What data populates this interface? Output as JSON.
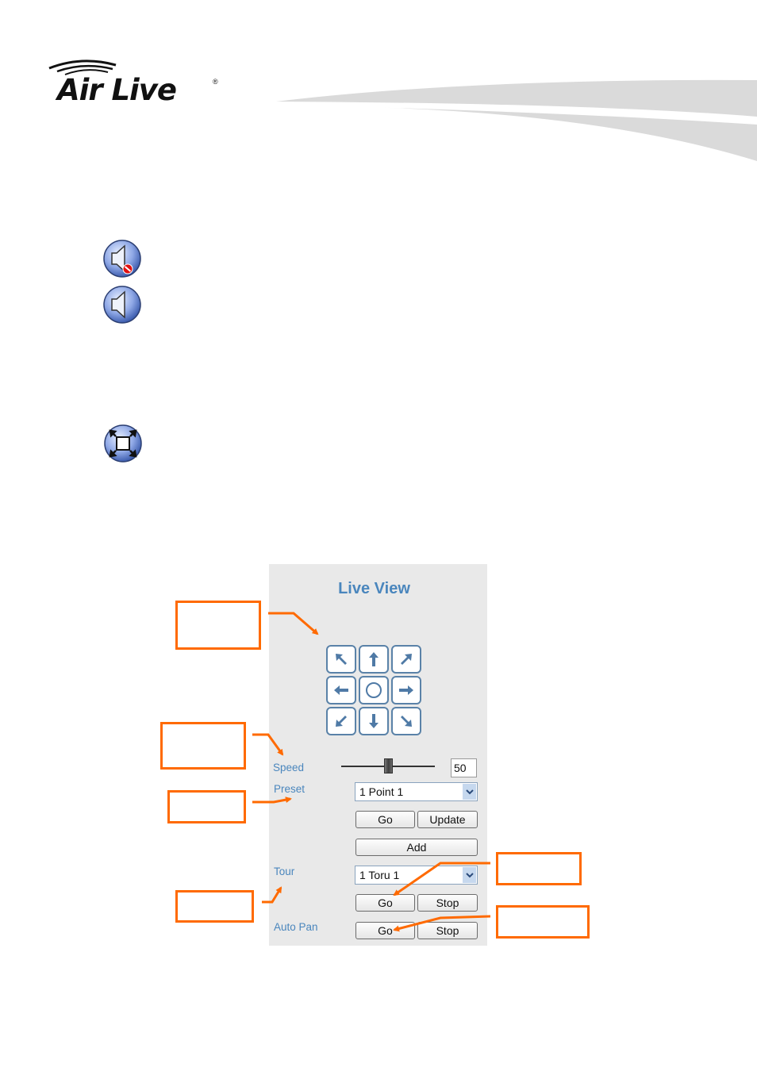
{
  "header": {
    "logo_text": "Air Live",
    "logo_registered": "®"
  },
  "icons": {
    "mute": "speaker-muted-icon",
    "audio": "speaker-icon",
    "fullscreen": "fullscreen-icon"
  },
  "live_view": {
    "title": "Live View",
    "ptz_buttons": [
      "up-left",
      "up",
      "up-right",
      "left",
      "home",
      "right",
      "down-left",
      "down",
      "down-right"
    ],
    "speed": {
      "label": "Speed",
      "value": "50",
      "fraction": 0.5
    },
    "preset": {
      "label": "Preset",
      "selected": "1 Point 1",
      "go_label": "Go",
      "update_label": "Update",
      "add_label": "Add"
    },
    "tour": {
      "label": "Tour",
      "selected": "1 Toru 1",
      "go_label": "Go",
      "stop_label": "Stop"
    },
    "auto_pan": {
      "label": "Auto Pan",
      "go_label": "Go",
      "stop_label": "Stop"
    }
  },
  "colors": {
    "accent": "#4a86bd",
    "callout": "#ff6a00",
    "panel_bg": "#e9e9e9"
  }
}
